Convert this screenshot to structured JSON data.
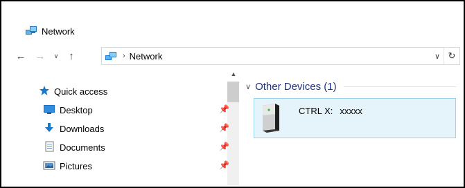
{
  "window": {
    "title": "Network",
    "title_icon": "network-icon"
  },
  "toolbar": {
    "back_icon": "arrow-left-icon",
    "forward_icon": "arrow-right-icon",
    "recent_icon": "chevron-down-icon",
    "up_icon": "arrow-up-icon"
  },
  "address": {
    "path": [
      "Network"
    ],
    "dropdown_icon": "chevron-down-icon",
    "refresh_icon": "refresh-icon"
  },
  "nav": {
    "items": [
      {
        "label": "Quick access",
        "icon": "star-icon",
        "pinned": false
      },
      {
        "label": "Desktop",
        "icon": "desktop-icon",
        "pinned": true
      },
      {
        "label": "Downloads",
        "icon": "download-icon",
        "pinned": true
      },
      {
        "label": "Documents",
        "icon": "documents-icon",
        "pinned": true
      },
      {
        "label": "Pictures",
        "icon": "pictures-icon",
        "pinned": true
      }
    ]
  },
  "content": {
    "group": {
      "label": "Other Devices (1)",
      "items": [
        {
          "name": "CTRL X:",
          "detail": "xxxxx",
          "icon": "computer-tower-icon"
        }
      ]
    }
  },
  "colors": {
    "group_header": "#1e3287",
    "selection_bg": "#e5f3fb",
    "selection_border": "#99d1ef",
    "accent_blue": "#1979ca"
  }
}
